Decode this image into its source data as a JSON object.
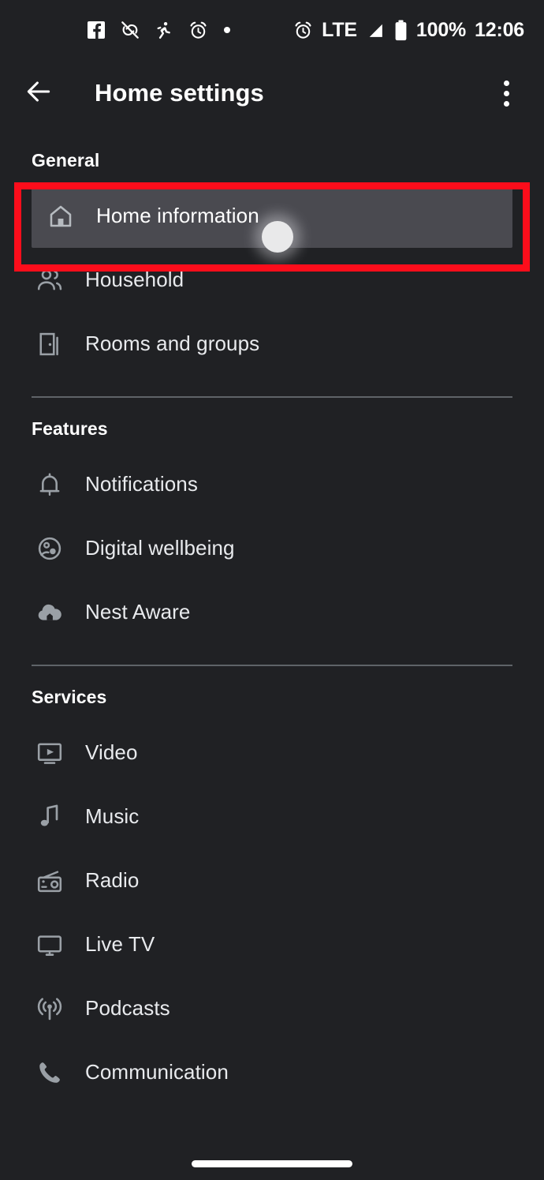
{
  "status_bar": {
    "left_icons": [
      {
        "name": "facebook-icon",
        "label": "Facebook"
      },
      {
        "name": "vibrate-muted-icon",
        "label": "Sound off"
      },
      {
        "name": "running-person-icon",
        "label": "Activity"
      },
      {
        "name": "alarm-clock-icon",
        "label": "Alarm"
      },
      {
        "name": "more-notifications-dot-icon",
        "label": "More"
      }
    ],
    "right": {
      "alarm_icon": "alarm-clock-icon",
      "network_type": "LTE",
      "signal_icon": "signal-strength-icon",
      "battery_icon": "battery-full-icon",
      "battery_percent": "100%",
      "clock": "12:06"
    }
  },
  "app_bar": {
    "back_icon": "back-arrow-icon",
    "title": "Home settings",
    "overflow_icon": "overflow-menu-icon"
  },
  "sections": [
    {
      "header": "General",
      "items": [
        {
          "label": "Home information",
          "icon": "home-icon",
          "highlighted": true
        },
        {
          "label": "Household",
          "icon": "people-icon",
          "highlighted": false
        },
        {
          "label": "Rooms and groups",
          "icon": "door-icon",
          "highlighted": false
        }
      ]
    },
    {
      "header": "Features",
      "items": [
        {
          "label": "Notifications",
          "icon": "bell-icon",
          "highlighted": false
        },
        {
          "label": "Digital wellbeing",
          "icon": "digital-wellbeing-icon",
          "highlighted": false
        },
        {
          "label": "Nest Aware",
          "icon": "nest-aware-cloud-icon",
          "highlighted": false
        }
      ]
    },
    {
      "header": "Services",
      "items": [
        {
          "label": "Video",
          "icon": "video-play-icon",
          "highlighted": false
        },
        {
          "label": "Music",
          "icon": "music-note-icon",
          "highlighted": false
        },
        {
          "label": "Radio",
          "icon": "radio-icon",
          "highlighted": false
        },
        {
          "label": "Live TV",
          "icon": "monitor-icon",
          "highlighted": false
        },
        {
          "label": "Podcasts",
          "icon": "podcast-broadcast-icon",
          "highlighted": false
        },
        {
          "label": "Communication",
          "icon": "phone-icon",
          "highlighted": false
        }
      ]
    }
  ],
  "annotation": {
    "highlight_color": "#fc0d1b",
    "target_item": "Home information"
  },
  "colors": {
    "background": "#202124",
    "selected_row": "#4a4a50",
    "primary_text": "#ffffff",
    "secondary_text": "#e8eaed",
    "icon": "#9aa0a6",
    "divider": "#5f6368"
  },
  "navigation": {
    "gesture_bar": "home-gesture-bar"
  }
}
